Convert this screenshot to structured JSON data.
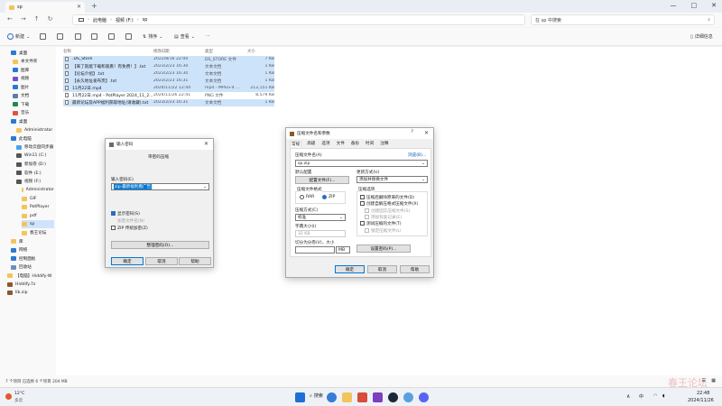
{
  "window": {
    "tab_title": "sp",
    "new_tab": "+",
    "minimize": "—",
    "maximize": "□",
    "close": "✕"
  },
  "address": {
    "crumbs": [
      "此电脑",
      "视频 (F:)",
      "sp"
    ],
    "search_placeholder": "在 sp 中搜索"
  },
  "command_bar": {
    "new": "新建",
    "sort": "排序",
    "view": "查看",
    "more": "···",
    "details": "详细信息"
  },
  "sidebar": {
    "items": [
      {
        "label": "桌面",
        "icon": "desktop-icon",
        "color": "#2b79d6"
      },
      {
        "label": "本文件夹",
        "icon": "folder-icon",
        "color": "#f2c55c"
      },
      {
        "label": "图库",
        "icon": "gallery-icon",
        "color": "#2b79d6"
      },
      {
        "label": "视频",
        "icon": "video-icon",
        "color": "#7a4fc9"
      },
      {
        "label": "图片",
        "icon": "picture-icon",
        "color": "#2b79d6"
      },
      {
        "label": "文档",
        "icon": "document-icon",
        "color": "#5a7fa8"
      },
      {
        "label": "下载",
        "icon": "download-icon",
        "color": "#1f8a4f"
      },
      {
        "label": "音乐",
        "icon": "music-icon",
        "color": "#e0553a"
      },
      {
        "label": "桌面",
        "icon": "desktop-icon",
        "color": "#2b79d6"
      },
      {
        "label": "Administrator",
        "icon": "folder-icon",
        "color": "#f2c55c"
      },
      {
        "label": "此电脑",
        "icon": "pc-icon",
        "color": "#2b79d6"
      },
      {
        "label": "移动云盘同步器",
        "icon": "cloud-icon",
        "color": "#4aa3ea"
      },
      {
        "label": "Win11 (C:)",
        "icon": "drive-icon",
        "color": "#555555"
      },
      {
        "label": "新加卷 (D:)",
        "icon": "drive-icon",
        "color": "#555555"
      },
      {
        "label": "软件 (E:)",
        "icon": "drive-icon",
        "color": "#555555"
      },
      {
        "label": "视频 (F:)",
        "icon": "drive-icon",
        "color": "#555555"
      },
      {
        "label": "Administrator",
        "icon": "folder-icon",
        "color": "#f2c55c"
      },
      {
        "label": "GIF",
        "icon": "folder-icon",
        "color": "#f2c55c"
      },
      {
        "label": "PotPlayer",
        "icon": "folder-icon",
        "color": "#f2c55c"
      },
      {
        "label": "pdf",
        "icon": "folder-icon",
        "color": "#f2c55c"
      },
      {
        "label": "sp",
        "icon": "folder-icon",
        "color": "#f2c55c"
      },
      {
        "label": "春王论坛",
        "icon": "folder-icon",
        "color": "#f2c55c"
      },
      {
        "label": "库",
        "icon": "library-icon",
        "color": "#f2c55c"
      },
      {
        "label": "网络",
        "icon": "network-icon",
        "color": "#2b79d6"
      },
      {
        "label": "控制面板",
        "icon": "control-panel-icon",
        "color": "#2b79d6"
      },
      {
        "label": "回收站",
        "icon": "recycle-bin-icon",
        "color": "#6d8fb8"
      },
      {
        "label": "【电脑】Hiddify-W",
        "icon": "folder-icon",
        "color": "#f2c55c"
      },
      {
        "label": "Hiddify.7z",
        "icon": "archive-icon",
        "color": "#8a5a2b"
      },
      {
        "label": "lib.zip",
        "icon": "archive-icon",
        "color": "#8a5a2b"
      }
    ]
  },
  "files": {
    "headers": {
      "name": "名称",
      "date": "修改日期",
      "type": "类型",
      "size": "大小"
    },
    "rows": [
      {
        "name": ".DS_Store",
        "date": "2022/8/16 22:00",
        "type": "DS_STORE 文件",
        "size": "7 KB",
        "selected": true
      },
      {
        "name": "【来了就能下载和观看！有免费！】.txt",
        "date": "2023/2/23 16:30",
        "type": "文本文档",
        "size": "1 KB",
        "selected": true
      },
      {
        "name": "【论坛介绍】.txt",
        "date": "2023/2/23 16:30",
        "type": "文本文档",
        "size": "1 KB",
        "selected": true
      },
      {
        "name": "【永久地址发布页】.txt",
        "date": "2023/2/23 16:31",
        "type": "文本文档",
        "size": "1 KB",
        "selected": true
      },
      {
        "name": "11月22日.mp4",
        "date": "2024/11/22 12:44",
        "type": "mp4 - MPEG-4 ...",
        "size": "212,151 KB",
        "selected": true
      },
      {
        "name": "11月22日.mp4 - PotPlayer 2024_11_2...",
        "date": "2024/11/26 22:41",
        "type": "PNG 文件",
        "size": "8,579 KB",
        "selected": false
      },
      {
        "name": "最新论坛及APP福利获取地址(请收藏).txt",
        "date": "2023/2/23 16:31",
        "type": "文本文档",
        "size": "1 KB",
        "selected": true
      }
    ]
  },
  "status": {
    "text": "7 个项目    已选择 6 个项目  204 MB"
  },
  "password_dialog": {
    "title": "输入密码",
    "subtitle": "带密码压缩",
    "label": "输入密码(E)",
    "value": "zip·最新福利看广告",
    "show_password": "显示密码(S)",
    "encrypt_names": "加密文件名(N)",
    "zip_legacy": "ZIP 传统加密(Z)",
    "organize": "整理密码(O)...",
    "ok": "确定",
    "cancel": "取消",
    "help": "帮助"
  },
  "archive_dialog": {
    "title": "压缩文件名和参数",
    "help_mark": "?",
    "tabs": [
      "常规",
      "高级",
      "选项",
      "文件",
      "备份",
      "时间",
      "注释"
    ],
    "archive_name_label": "压缩文件名(A)",
    "browse": "浏览(B)...",
    "archive_name": "sp.zip",
    "default_profile_label": "默认配置",
    "profile_button": "配置文件(F)...",
    "update_mode_label": "更新方式(U)",
    "update_mode": "添加并替换文件",
    "format_label": "压缩文件格式",
    "format_rar": "RAR",
    "format_zip": "ZIP",
    "method_label": "压缩方式(C)",
    "method": "标准",
    "dict_label": "字典大小(I)",
    "dict_value": "32 KB",
    "split_label": "切分为分卷(V)，大小",
    "split_unit": "MB",
    "options_label": "压缩选项",
    "options": [
      {
        "label": "压缩后删除原来的文件(D)",
        "disabled": false
      },
      {
        "label": "创建自解压格式压缩文件(X)",
        "disabled": false
      },
      {
        "label": "创建固实压缩文件(S)",
        "disabled": true
      },
      {
        "label": "添加恢复记录(E)",
        "disabled": true
      },
      {
        "label": "测试压缩的文件(T)",
        "disabled": false
      },
      {
        "label": "锁定压缩文件(L)",
        "disabled": true
      }
    ],
    "set_password": "设置密码(P)...",
    "ok": "确定",
    "cancel": "取消",
    "help": "帮助"
  },
  "taskbar": {
    "weather_temp": "12°C",
    "weather_desc": "多云",
    "search": "搜索",
    "ime": "中",
    "time": "22:48",
    "date": "2024/11/26",
    "watermark": "春王论坛"
  },
  "colors": {
    "accent": "#0078d7",
    "selection": "#cde3fa",
    "folder": "#f2c55c"
  }
}
